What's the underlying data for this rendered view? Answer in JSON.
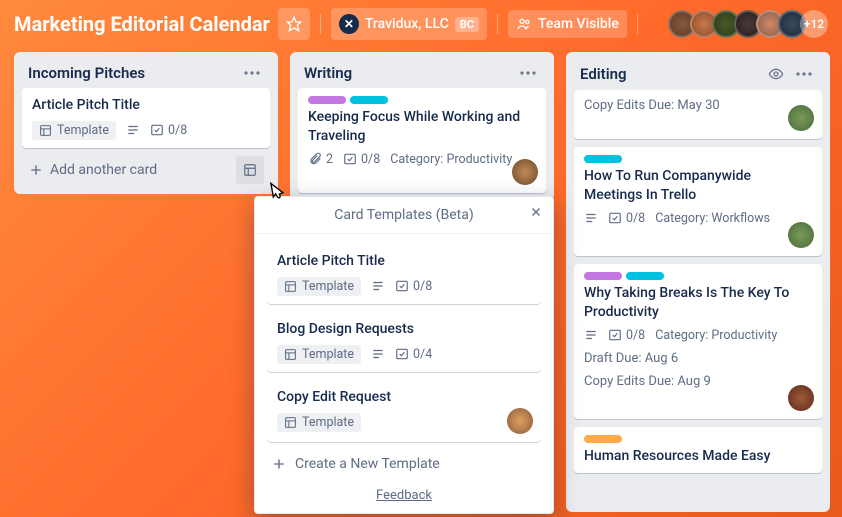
{
  "header": {
    "title": "Marketing Editorial Calendar",
    "org_name": "Travidux, LLC",
    "org_badge": "BC",
    "visibility": "Team Visible",
    "extra_members": "+12"
  },
  "lists": {
    "incoming": {
      "title": "Incoming Pitches",
      "card_title": "Article Pitch Title",
      "template_label": "Template",
      "checklist": "0/8",
      "add_card": "Add another card"
    },
    "writing": {
      "title": "Writing",
      "card1": {
        "title": "Keeping Focus While Working and Traveling",
        "attachments": "2",
        "checklist": "0/8",
        "category": "Category: Productivity"
      }
    },
    "editing": {
      "title": "Editing",
      "card1": {
        "extra": "Copy Edits Due: May 30"
      },
      "card2": {
        "title": "How To Run Companywide Meetings In Trello",
        "checklist": "0/8",
        "category": "Category: Workflows"
      },
      "card3": {
        "title": "Why Taking Breaks Is The Key To Productivity",
        "checklist": "0/8",
        "category": "Category: Productivity",
        "draft": "Draft Due: Aug 6",
        "copy": "Copy Edits Due: Aug 9"
      },
      "card4": {
        "title": "Human Resources Made Easy"
      }
    }
  },
  "popover": {
    "title": "Card Templates (Beta)",
    "template_label": "Template",
    "t1": {
      "title": "Article Pitch Title",
      "checklist": "0/8"
    },
    "t2": {
      "title": "Blog Design Requests",
      "checklist": "0/4"
    },
    "t3": {
      "title": "Copy Edit Request"
    },
    "new": "Create a New Template",
    "feedback": "Feedback"
  }
}
